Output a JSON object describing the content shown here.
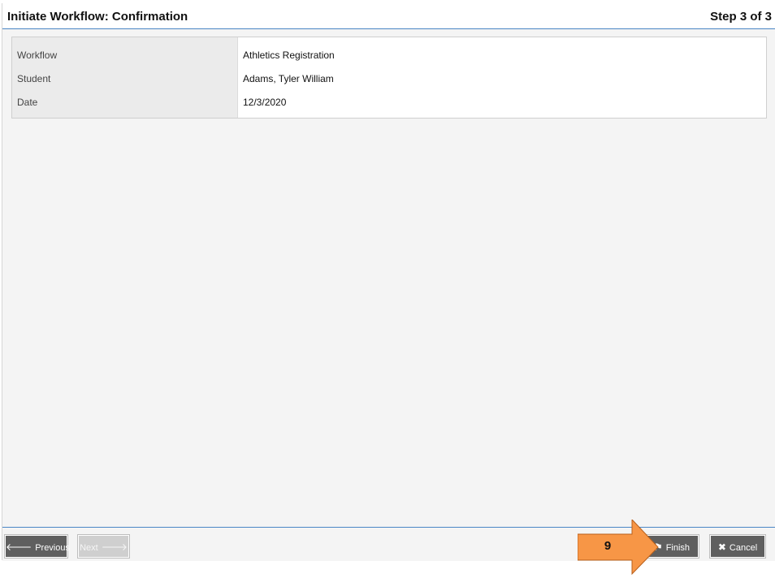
{
  "header": {
    "title": "Initiate Workflow: Confirmation",
    "step": "Step 3 of 3"
  },
  "details": {
    "rows": [
      {
        "label": "Workflow",
        "value": "Athletics Registration"
      },
      {
        "label": "Student",
        "value": "Adams, Tyler William"
      },
      {
        "label": "Date",
        "value": "12/3/2020"
      }
    ]
  },
  "footer": {
    "previous_label": "Previous",
    "next_label": "Next",
    "finish_label": "Finish",
    "cancel_label": "Cancel"
  },
  "annotation": {
    "callout_number": "9",
    "callout_color": "#f79646"
  },
  "icons": {
    "previous": "arrow-left-icon",
    "next": "arrow-right-icon",
    "finish": "flag-icon",
    "cancel": "x-icon"
  }
}
